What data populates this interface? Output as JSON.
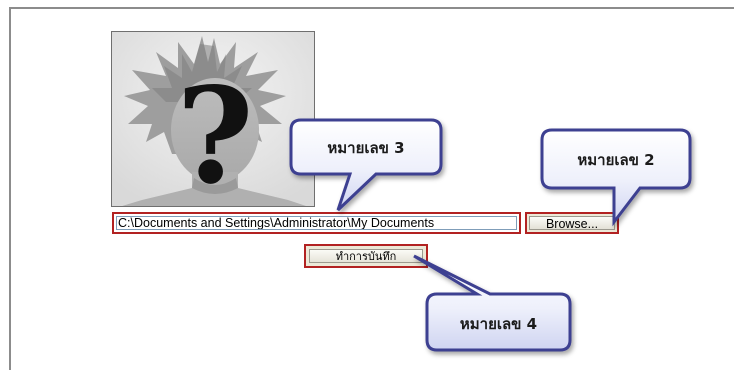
{
  "upload_form": {
    "file_path_value": "C:\\Documents and Settings\\Administrator\\My Documents",
    "browse_label": "Browse...",
    "save_label": "ทำการบันทึก"
  },
  "callouts": [
    {
      "label": "หมายเลข 3",
      "target": "file-path-field"
    },
    {
      "label": "หมายเลข 2",
      "target": "browse-button"
    },
    {
      "label": "หมายเลข 4",
      "target": "save-button"
    }
  ],
  "colors": {
    "highlight_border": "#b22222",
    "callout_fill": "#e9ecfa",
    "callout_border": "#3d3f91"
  },
  "icons": {
    "avatar": "unknown-user-question-mark-icon"
  }
}
